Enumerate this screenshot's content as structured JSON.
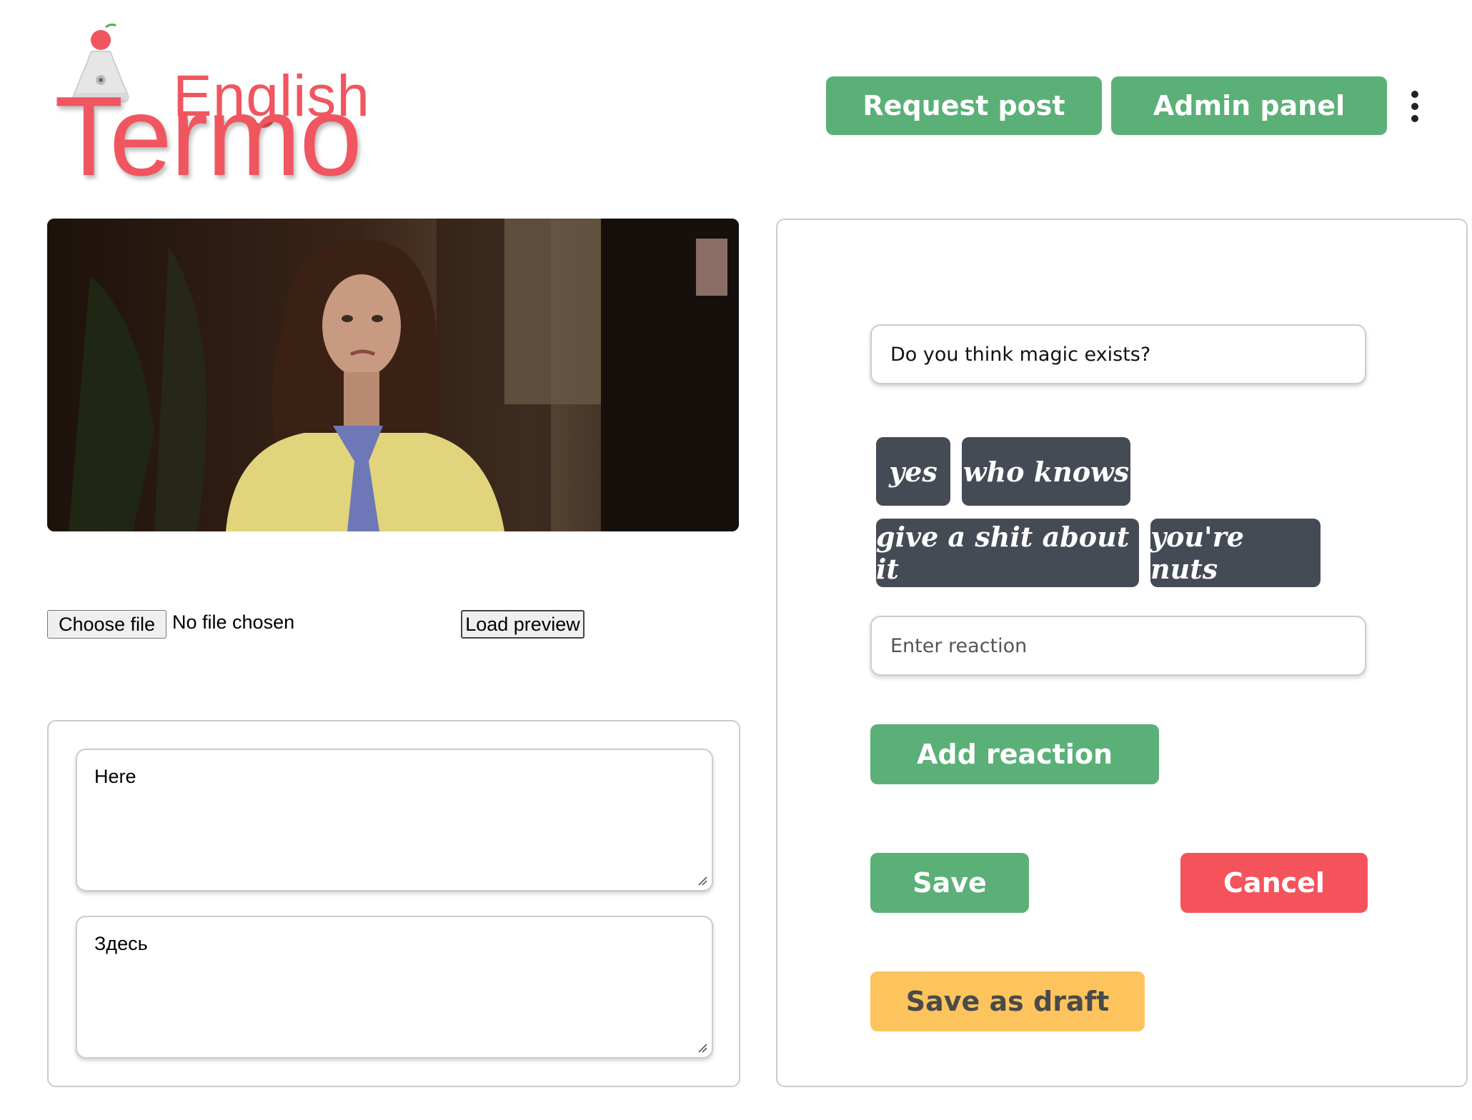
{
  "brand": {
    "word_small": "English",
    "word_large": "Termo",
    "color": "#f0565f"
  },
  "header": {
    "request_post": "Request post",
    "admin_panel": "Admin panel",
    "menu_icon": "kebab-menu-icon"
  },
  "media": {
    "choose_file": "Choose file",
    "no_file": "No file chosen",
    "load_preview": "Load preview"
  },
  "text_fields": {
    "english": "Here",
    "russian": "Здесь"
  },
  "post": {
    "question": "Do you think magic exists?",
    "reactions": [
      "yes",
      "who knows",
      "give a shit about it",
      "you're nuts"
    ],
    "reaction_placeholder": "Enter reaction",
    "add_reaction": "Add reaction",
    "save": "Save",
    "cancel": "Cancel",
    "save_draft": "Save as draft"
  },
  "colors": {
    "green": "#5bb077",
    "red": "#f5535c",
    "yellow": "#fdc45d",
    "chip": "#454b55"
  }
}
